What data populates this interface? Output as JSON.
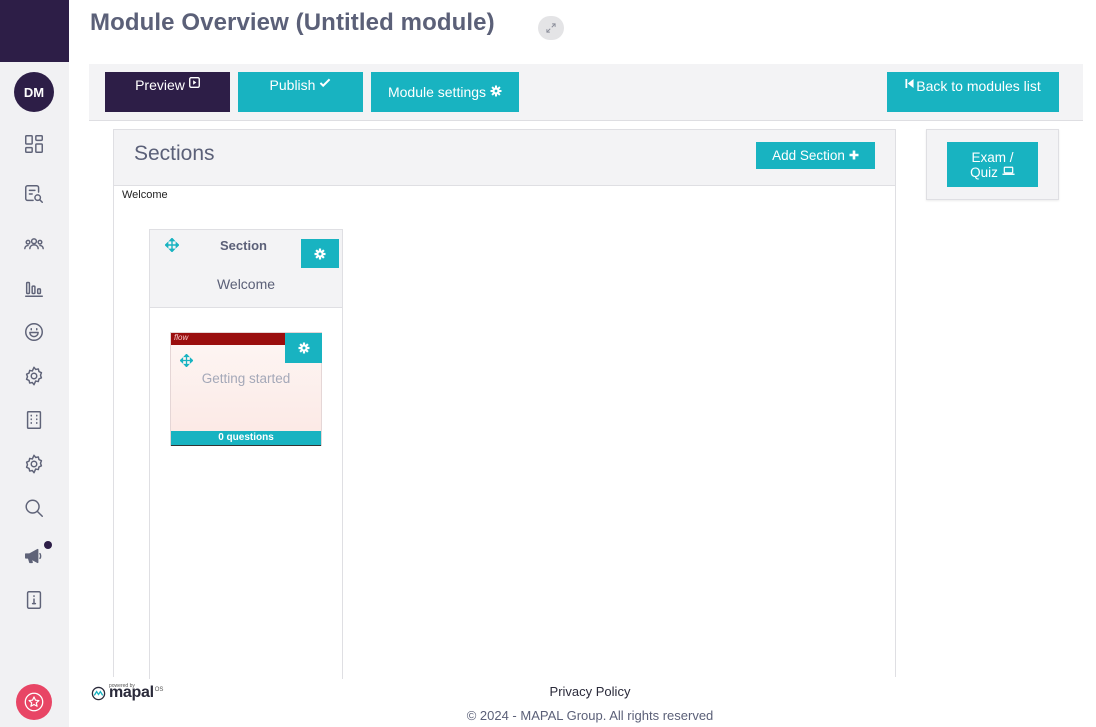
{
  "sidebar": {
    "avatar_initials": "DM",
    "icons": [
      "dashboard-icon",
      "search-document-icon",
      "users-icon",
      "bar-chart-icon",
      "smiley-icon",
      "settings-icon",
      "building-icon",
      "gear-icon",
      "search-icon",
      "megaphone-icon",
      "info-book-icon"
    ]
  },
  "header": {
    "title": "Module Overview (Untitled module)"
  },
  "toolbar": {
    "preview_label": "Preview",
    "publish_label": "Publish",
    "module_settings_label": "Module settings",
    "back_label": "Back to modules list"
  },
  "sections": {
    "title": "Sections",
    "add_section_label": "Add Section",
    "welcome_tag": "Welcome",
    "cards": [
      {
        "label": "Section",
        "name": "Welcome",
        "lessons": [
          {
            "thumb_text": "flow",
            "title": "Getting started",
            "questions_label": "0 questions"
          }
        ]
      }
    ]
  },
  "exam": {
    "label_line1": "Exam /",
    "label_line2": "Quiz"
  },
  "footer": {
    "powered_by": "powered by",
    "brand_name": "mapal",
    "brand_suffix": "OS",
    "privacy_label": "Privacy Policy",
    "copyright": "© 2024 - MAPAL Group. All rights reserved"
  },
  "colors": {
    "primary_dark": "#2d1e47",
    "accent_teal": "#18b3c1",
    "panel_bg": "#f3f3f5",
    "text": "#5b6078",
    "star_button": "#e84565"
  }
}
